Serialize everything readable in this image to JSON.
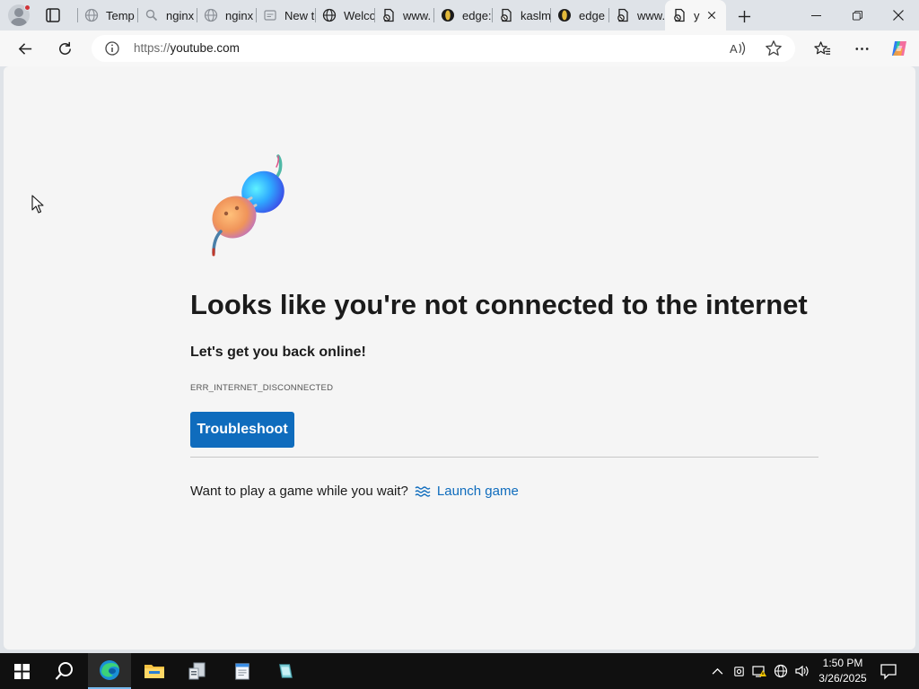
{
  "browser": {
    "tabs": [
      {
        "label": "Temp",
        "icon": "globe-icon"
      },
      {
        "label": "nginx",
        "icon": "search-icon"
      },
      {
        "label": "nginx",
        "icon": "globe-icon"
      },
      {
        "label": "New t",
        "icon": "newtab-icon"
      },
      {
        "label": "Welco",
        "icon": "globe-icon"
      },
      {
        "label": "www.",
        "icon": "page-error-icon"
      },
      {
        "label": "edge:",
        "icon": "edge-dev-icon"
      },
      {
        "label": "kaslm",
        "icon": "page-error-icon"
      },
      {
        "label": "edge",
        "icon": "edge-dev-icon"
      },
      {
        "label": "www.",
        "icon": "page-error-icon"
      },
      {
        "label": "y",
        "icon": "page-error-icon",
        "active": true
      }
    ],
    "address": {
      "scheme": "https://",
      "host": "youtube.com"
    }
  },
  "page": {
    "heading": "Looks like you're not connected to the internet",
    "subheading": "Let's get you back online!",
    "error_code": "ERR_INTERNET_DISCONNECTED",
    "troubleshoot_label": "Troubleshoot",
    "game_prompt": "Want to play a game while you wait?",
    "launch_game_label": "Launch game"
  },
  "taskbar": {
    "time": "1:50 PM",
    "date": "3/26/2025"
  },
  "colors": {
    "accent": "#0f6cbd",
    "chrome": "#dfe3e8",
    "page_bg": "#f5f5f5",
    "taskbar": "#101010"
  }
}
